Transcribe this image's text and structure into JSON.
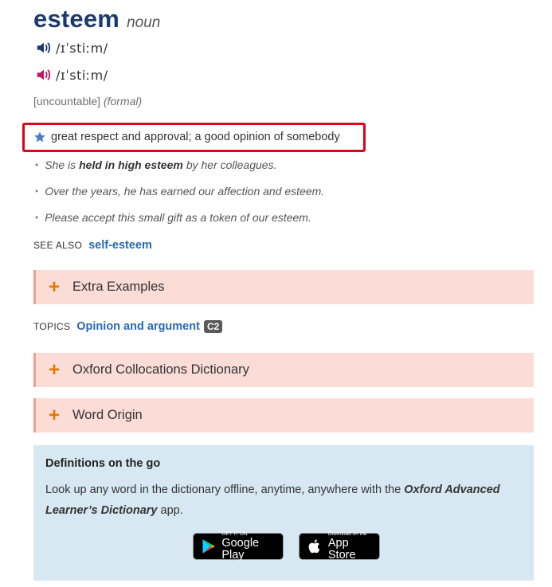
{
  "entry": {
    "headword": "esteem",
    "part_of_speech": "noun",
    "pronunciations": [
      {
        "accent": "uk",
        "ipa": "/ɪˈstiːm/",
        "color": "#1d3a6e"
      },
      {
        "accent": "us",
        "ipa": "/ɪˈstiːm/",
        "color": "#c2185b"
      }
    ],
    "grammar": "[uncountable]",
    "register": "(formal)",
    "definition": "great respect and approval; a good opinion of somebody",
    "examples": [
      {
        "pre": "She is",
        "bold": "held in high esteem",
        "post": "by her colleagues."
      },
      {
        "pre": "Over the years, he has earned our affection and esteem.",
        "bold": "",
        "post": ""
      },
      {
        "pre": "Please accept this small gift as a token of our esteem.",
        "bold": "",
        "post": ""
      }
    ]
  },
  "see_also": {
    "label": "SEE ALSO",
    "link": "self-esteem"
  },
  "sections": {
    "extra_examples": "Extra Examples",
    "collocations": "Oxford Collocations Dictionary",
    "word_origin": "Word Origin"
  },
  "topics": {
    "label": "TOPICS",
    "link": "Opinion and argument",
    "level": "C2"
  },
  "promo": {
    "title": "Definitions on the go",
    "text_pre": "Look up any word in the dictionary offline, anytime, anywhere with the",
    "text_bold": "Oxford Advanced Learner’s Dictionary",
    "text_post": "app.",
    "google_play_small": "GET IT ON",
    "google_play_big": "Google Play",
    "app_store_small": "Download on the",
    "app_store_big": "App Store"
  },
  "colors": {
    "accent_plus": "#e07a00",
    "section_bg": "#fbdcd7",
    "promo_bg": "#d7e8f3",
    "link": "#2a6ab4",
    "highlight_border": "#e0001b"
  }
}
